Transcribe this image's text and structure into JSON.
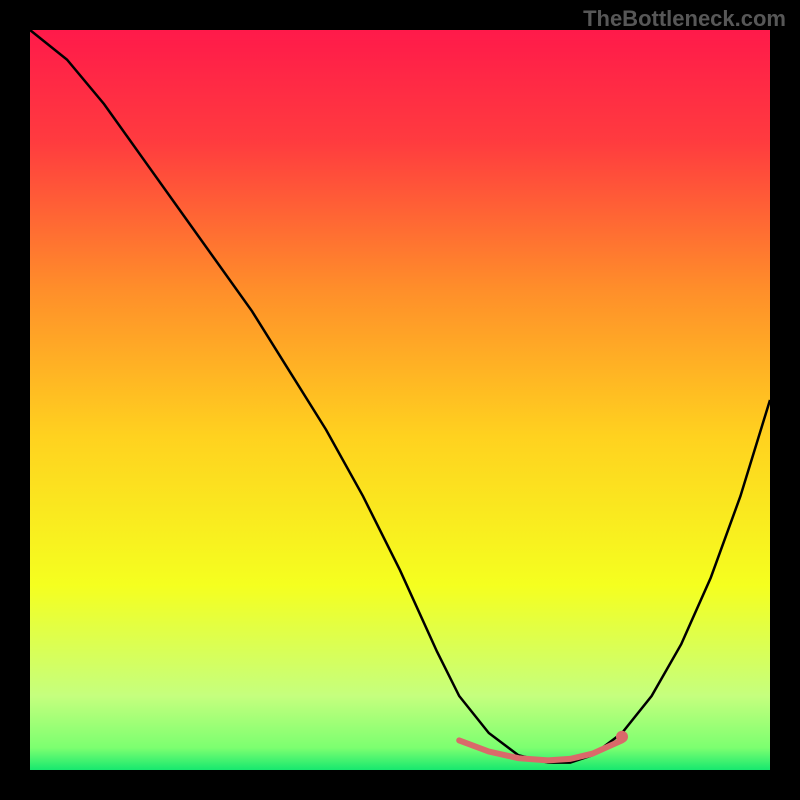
{
  "watermark": "TheBottleneck.com",
  "chart_data": {
    "type": "line",
    "title": "",
    "xlabel": "",
    "ylabel": "",
    "xlim": [
      0,
      100
    ],
    "ylim": [
      0,
      100
    ],
    "background_gradient": {
      "stops": [
        {
          "offset": 0.0,
          "color": "#ff1a4a"
        },
        {
          "offset": 0.15,
          "color": "#ff3b3f"
        },
        {
          "offset": 0.35,
          "color": "#ff8e2a"
        },
        {
          "offset": 0.55,
          "color": "#ffd21f"
        },
        {
          "offset": 0.75,
          "color": "#f5ff1f"
        },
        {
          "offset": 0.9,
          "color": "#c5ff7e"
        },
        {
          "offset": 0.97,
          "color": "#7cff70"
        },
        {
          "offset": 1.0,
          "color": "#17e86f"
        }
      ]
    },
    "series": [
      {
        "name": "curve",
        "type": "line",
        "color": "#000000",
        "x": [
          0,
          5,
          10,
          15,
          20,
          25,
          30,
          35,
          40,
          45,
          50,
          55,
          58,
          62,
          66,
          70,
          73,
          76,
          80,
          84,
          88,
          92,
          96,
          100
        ],
        "y": [
          100,
          96,
          90,
          83,
          76,
          69,
          62,
          54,
          46,
          37,
          27,
          16,
          10,
          5,
          2,
          1,
          1,
          2,
          5,
          10,
          17,
          26,
          37,
          50
        ]
      },
      {
        "name": "highlight-band",
        "type": "line",
        "color": "#d96a6a",
        "stroke_width": 6,
        "x": [
          58,
          62,
          66,
          70,
          73,
          76,
          80
        ],
        "y": [
          4,
          2.5,
          1.6,
          1.3,
          1.5,
          2.2,
          4
        ]
      },
      {
        "name": "marker",
        "type": "scatter",
        "color": "#d96a6a",
        "x": [
          80
        ],
        "y": [
          4.5
        ]
      }
    ]
  }
}
